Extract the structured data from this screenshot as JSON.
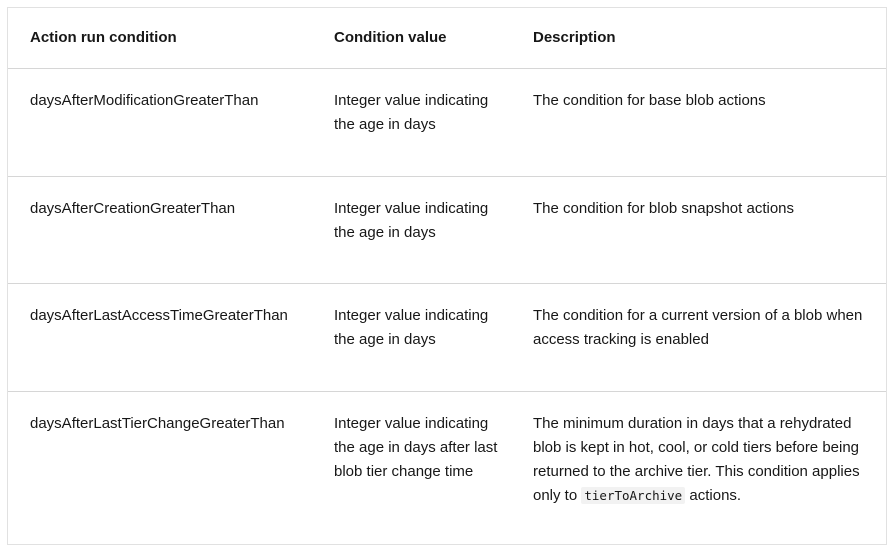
{
  "table": {
    "headers": [
      "Action run condition",
      "Condition value",
      "Description"
    ],
    "rows": [
      {
        "condition": "daysAfterModificationGreaterThan",
        "value": "Integer value indicating the age in days",
        "description": "The condition for base blob actions"
      },
      {
        "condition": "daysAfterCreationGreaterThan",
        "value": "Integer value indicating the age in days",
        "description": "The condition for blob snapshot actions"
      },
      {
        "condition": "daysAfterLastAccessTimeGreaterThan",
        "value": "Integer value indicating the age in days",
        "description": "The condition for a current version of a blob when access tracking is enabled"
      },
      {
        "condition": "daysAfterLastTierChangeGreaterThan",
        "value": "Integer value indicating the age in days after last blob tier change time",
        "description_before_code": "The minimum duration in days that a rehydrated blob is kept in hot, cool, or cold tiers before being returned to the archive tier. This condition applies only to ",
        "description_code": "tierToArchive",
        "description_after_code": " actions."
      }
    ]
  }
}
